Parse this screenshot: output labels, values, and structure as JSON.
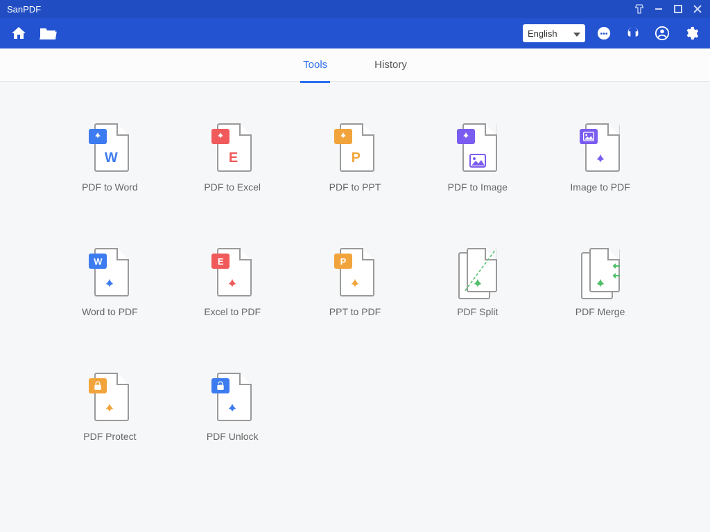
{
  "window": {
    "title": "SanPDF"
  },
  "toolbar": {
    "language": "English"
  },
  "tabs": {
    "tools": "Tools",
    "history": "History",
    "active": "tools"
  },
  "tools": [
    {
      "id": "pdf-to-word",
      "label": "PDF to Word",
      "badge": {
        "kind": "pdf",
        "color": "c-blue"
      },
      "sub": {
        "text": "W",
        "color": "t-blue"
      }
    },
    {
      "id": "pdf-to-excel",
      "label": "PDF to Excel",
      "badge": {
        "kind": "pdf",
        "color": "c-red"
      },
      "sub": {
        "text": "E",
        "color": "t-red"
      }
    },
    {
      "id": "pdf-to-ppt",
      "label": "PDF to PPT",
      "badge": {
        "kind": "pdf",
        "color": "c-orange"
      },
      "sub": {
        "text": "P",
        "color": "t-orange"
      }
    },
    {
      "id": "pdf-to-image",
      "label": "PDF to Image",
      "badge": {
        "kind": "pdf",
        "color": "c-purple"
      },
      "sub": {
        "kind": "image",
        "color": "t-purple"
      }
    },
    {
      "id": "image-to-pdf",
      "label": "Image to PDF",
      "badge": {
        "kind": "image",
        "color": "c-purple"
      },
      "sub": {
        "kind": "pdf",
        "color": "t-purple"
      }
    },
    {
      "id": "word-to-pdf",
      "label": "Word to PDF",
      "badge": {
        "text": "W",
        "color": "c-blue"
      },
      "sub": {
        "kind": "pdf",
        "color": "t-blue"
      }
    },
    {
      "id": "excel-to-pdf",
      "label": "Excel to PDF",
      "badge": {
        "text": "E",
        "color": "c-red"
      },
      "sub": {
        "kind": "pdf",
        "color": "t-red"
      }
    },
    {
      "id": "ppt-to-pdf",
      "label": "PPT to PDF",
      "badge": {
        "text": "P",
        "color": "c-orange"
      },
      "sub": {
        "kind": "pdf",
        "color": "t-orange"
      }
    },
    {
      "id": "pdf-split",
      "label": "PDF Split",
      "double": true,
      "diag": true,
      "sub": {
        "kind": "pdf",
        "color": "t-green"
      }
    },
    {
      "id": "pdf-merge",
      "label": "PDF Merge",
      "double": true,
      "arrows": true,
      "sub": {
        "kind": "pdf",
        "color": "t-green"
      }
    },
    {
      "id": "pdf-protect",
      "label": "PDF Protect",
      "badge": {
        "kind": "lock",
        "color": "c-orange"
      },
      "sub": {
        "kind": "pdf",
        "color": "t-orange"
      }
    },
    {
      "id": "pdf-unlock",
      "label": "PDF Unlock",
      "badge": {
        "kind": "unlock",
        "color": "c-blue"
      },
      "sub": {
        "kind": "pdf",
        "color": "t-blue"
      }
    }
  ]
}
